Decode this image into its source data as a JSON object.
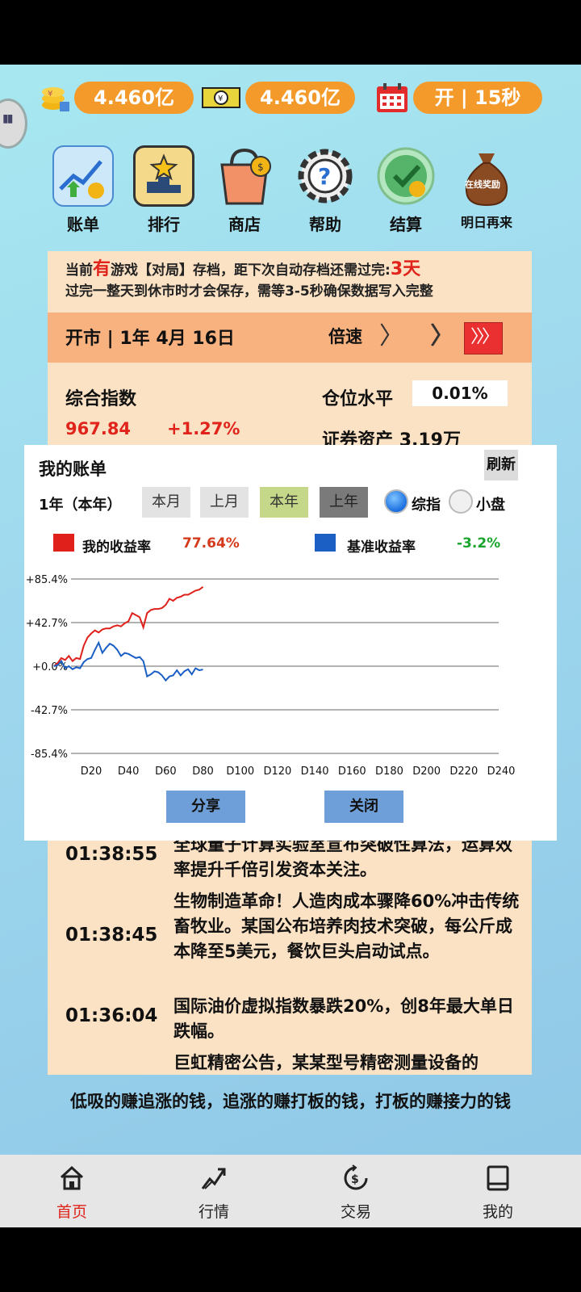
{
  "stats": {
    "cash": "4.460亿",
    "assets": "4.460亿",
    "market_status": "开 | 15秒"
  },
  "menu": [
    {
      "label": "账单",
      "icon": "bill-icon"
    },
    {
      "label": "排行",
      "icon": "ranking-icon"
    },
    {
      "label": "商店",
      "icon": "shop-icon"
    },
    {
      "label": "帮助",
      "icon": "help-icon"
    },
    {
      "label": "结算",
      "icon": "settle-icon"
    },
    {
      "label": "明日再来",
      "icon": "reward-bag-icon",
      "badge": "在线奖励"
    }
  ],
  "notice": {
    "line1_prefix": "当前",
    "line1_highlight": "有",
    "line1_mid": "游戏【对局】存档，距下次自动存档还需过完:",
    "line1_days": "3天",
    "line2": "过完一整天到休市时才会保存，需等3-5秒确保数据写入完整"
  },
  "date_bar": {
    "date": "开市 | 1年 4月 16日",
    "speed_label": "倍速",
    "speed_1": "〉",
    "speed_2": "〉〉",
    "speed_3": "〉〉〉"
  },
  "overview": {
    "index_title": "综合指数",
    "position_label": "仓位水平",
    "position_value": "0.01%",
    "index_value": "967.84",
    "index_change": "+1.27%",
    "securities_label": "证券资产",
    "securities_value": "3.19万"
  },
  "news": [
    {
      "time": "01:38:55",
      "text": "全球量子计算实验室宣布突破性算法，运算效率提升千倍引发资本关注。"
    },
    {
      "time": "01:38:45",
      "text": "生物制造革命！人造肉成本骤降60%冲击传统畜牧业。某国公布培养肉技术突破，每公斤成本降至5美元，餐饮巨头启动试点。"
    },
    {
      "time": "01:36:04",
      "text": "国际油价虚拟指数暴跌20%，创8年最大单日跌幅。"
    },
    {
      "time": "",
      "text": "巨虹精密公告，某某型号精密测量设备的"
    }
  ],
  "slogan": "低吸的赚追涨的钱，追涨的赚打板的钱，打板的赚接力的钱",
  "bottom_nav": [
    {
      "label": "首页",
      "icon": "home-icon",
      "active": true
    },
    {
      "label": "行情",
      "icon": "trend-icon",
      "active": false
    },
    {
      "label": "交易",
      "icon": "trade-icon",
      "active": false
    },
    {
      "label": "我的",
      "icon": "book-icon",
      "active": false
    }
  ],
  "modal": {
    "title": "我的账单",
    "refresh": "刷新",
    "year_label": "1年（本年）",
    "period_buttons": [
      "本月",
      "上月",
      "本年",
      "上年"
    ],
    "active_period": "本年",
    "radio_options": [
      "综指",
      "小盘"
    ],
    "selected_radio": "综指",
    "legend_mine_label": "我的收益率",
    "legend_mine_value": "77.64%",
    "legend_bench_label": "基准收益率",
    "legend_bench_value": "-3.2%",
    "share": "分享",
    "close": "关闭",
    "colors": {
      "mine": "#e0201a",
      "bench": "#1b5fc4",
      "positive": "#d53a1c",
      "negative": "#19a52c"
    }
  },
  "chart_data": {
    "type": "line",
    "y_ticks": [
      "+85.4%",
      "+42.7%",
      "+0.0%",
      "-42.7%",
      "-85.4%"
    ],
    "x_ticks": [
      "D20",
      "D40",
      "D60",
      "D80",
      "D100",
      "D120",
      "D140",
      "D160",
      "D180",
      "D200",
      "D220",
      "D240"
    ],
    "ylim": [
      -85.4,
      85.4
    ],
    "xlim": [
      0,
      240
    ],
    "grid": true,
    "series": [
      {
        "name": "我的收益率",
        "color": "#e0201a",
        "x": [
          0,
          2,
          4,
          6,
          8,
          10,
          12,
          14,
          16,
          18,
          20,
          22,
          24,
          26,
          28,
          30,
          32,
          34,
          36,
          38,
          40,
          42,
          44,
          46,
          48,
          50,
          52,
          54,
          56,
          58,
          60,
          62,
          64,
          66,
          68,
          70,
          72,
          74,
          76,
          78,
          80
        ],
        "values": [
          0,
          3,
          8,
          6,
          10,
          5,
          8,
          7,
          20,
          28,
          32,
          35,
          33,
          36,
          37,
          37,
          39,
          40,
          39,
          42,
          44,
          52,
          50,
          48,
          38,
          52,
          55,
          56,
          56,
          57,
          60,
          66,
          64,
          67,
          68,
          70,
          70,
          72,
          74,
          75,
          77.6
        ]
      },
      {
        "name": "基准收益率",
        "color": "#1b5fc4",
        "x": [
          0,
          2,
          4,
          6,
          8,
          10,
          12,
          14,
          16,
          18,
          20,
          22,
          24,
          26,
          28,
          30,
          32,
          34,
          36,
          38,
          40,
          42,
          44,
          46,
          48,
          50,
          52,
          54,
          56,
          58,
          60,
          62,
          64,
          66,
          68,
          70,
          72,
          74,
          76,
          78,
          80
        ],
        "values": [
          0,
          1,
          5,
          -2,
          0,
          -3,
          -1,
          -2,
          4,
          7,
          8,
          16,
          23,
          13,
          18,
          22,
          20,
          16,
          10,
          13,
          12,
          10,
          8,
          9,
          5,
          -10,
          -8,
          -5,
          -6,
          -9,
          -14,
          -10,
          -9,
          -4,
          -9,
          -5,
          -3,
          -8,
          -2,
          -4,
          -3.2
        ]
      }
    ]
  }
}
